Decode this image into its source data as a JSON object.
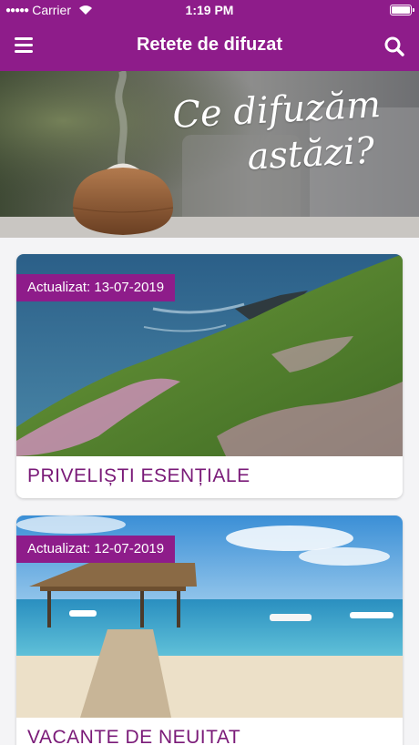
{
  "status_bar": {
    "carrier": "Carrier",
    "time": "1:19 PM"
  },
  "nav": {
    "title": "Retete de difuzat",
    "menu_icon": "hamburger-menu-icon",
    "search_icon": "search-icon"
  },
  "hero": {
    "slogan_line1": "Ce difuzăm",
    "slogan_line2": "astăzi?"
  },
  "cards": [
    {
      "badge": "Actualizat: 13-07-2019",
      "title": "PRIVELIȘTI ESENȚIALE"
    },
    {
      "badge": "Actualizat: 12-07-2019",
      "title": "VACANTE DE NEUITAT"
    }
  ],
  "colors": {
    "brand": "#8e1c8a",
    "title_text": "#7a1a78"
  }
}
